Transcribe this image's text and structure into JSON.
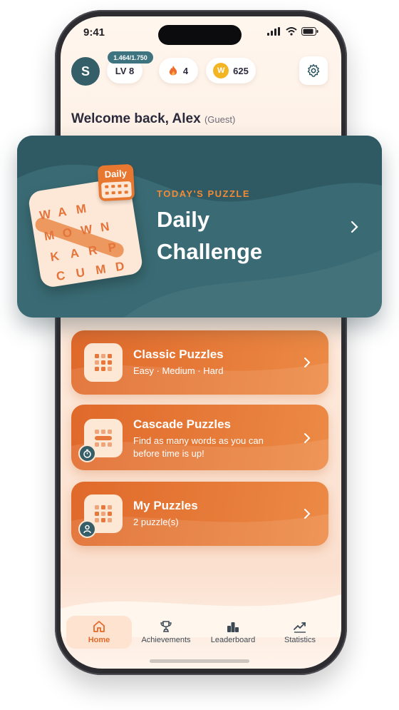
{
  "status_bar": {
    "time": "9:41"
  },
  "header": {
    "avatar_initial": "S",
    "xp": "1.464/1.750",
    "level": "LV 8",
    "streak": "4",
    "coin_letter": "W",
    "coins": "625"
  },
  "welcome": {
    "text": "Welcome back, Alex",
    "guest": "(Guest)"
  },
  "daily": {
    "tag": "TODAY'S PUZZLE",
    "title": "Daily Challenge",
    "calendar_label": "Daily",
    "letters": [
      "W",
      "A",
      "M",
      "M",
      "O",
      "W",
      "N",
      "K",
      "A",
      "R",
      "P",
      "C",
      "U",
      "M",
      "D"
    ]
  },
  "cards": [
    {
      "title": "Classic Puzzles",
      "subtitle": "Easy · Medium · Hard"
    },
    {
      "title": "Cascade Puzzles",
      "subtitle": "Find as many words as you can before time is up!"
    },
    {
      "title": "My Puzzles",
      "subtitle": "2 puzzle(s)"
    }
  ],
  "tabs": [
    "Home",
    "Achievements",
    "Leaderboard",
    "Statistics"
  ],
  "colors": {
    "teal": "#3a6b74",
    "orange": "#e8772f",
    "accent_text": "#f08a36"
  }
}
